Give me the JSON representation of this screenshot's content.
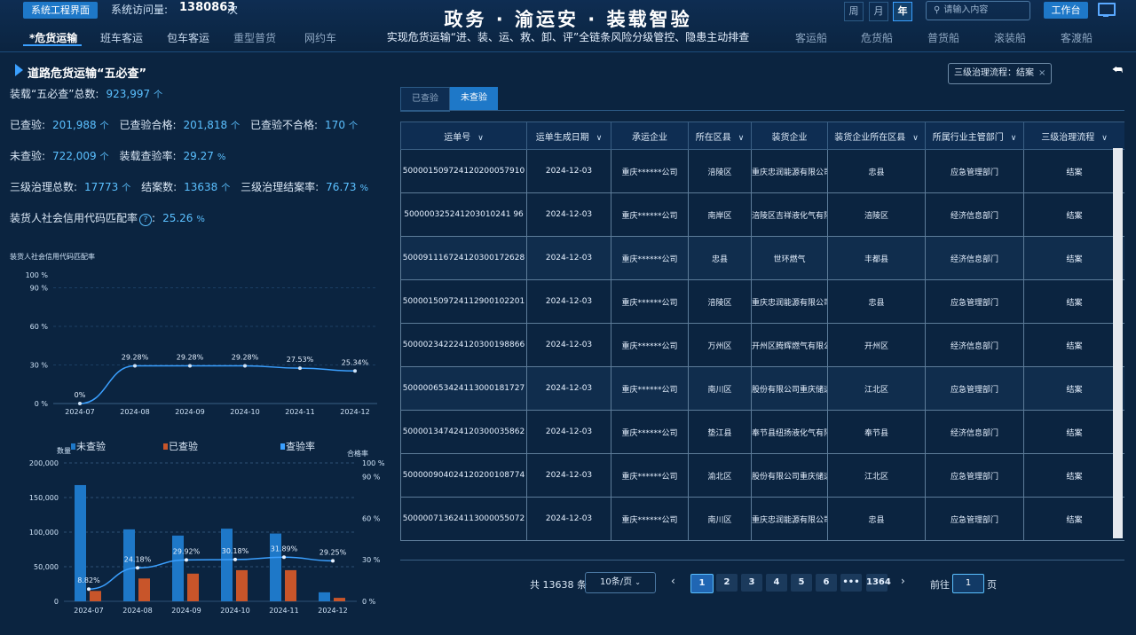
{
  "header": {
    "system_button": "系统工程界面",
    "visit_label": "系统访问量:",
    "visit_count": "1380863",
    "visit_unit": "次",
    "title": "政务 · 渝运安 · 装载智验",
    "subtitle": "实现危货运输“进、装、运、救、卸、评”全链条风险分级管控、隐患主动排查",
    "periods": [
      "周",
      "月",
      "年"
    ],
    "active_period": "年",
    "search_placeholder": "请输入内容",
    "workbench_button": "工作台",
    "nav_left": [
      "*危货运输",
      "班车客运",
      "包车客运",
      "重型普货",
      "网约车"
    ],
    "nav_right": [
      "客运船",
      "危货船",
      "普货船",
      "滚装船",
      "客渡船"
    ],
    "active_nav": "*危货运输"
  },
  "left": {
    "section_title": "道路危货运输“五必查”",
    "stats": {
      "total_label": "装载“五必查”总数:",
      "total_value": "923,997",
      "unit": "个",
      "checked_label": "已查验:",
      "checked_value": "201,988",
      "qualified_label": "已查验合格:",
      "qualified_value": "201,818",
      "unqualified_label": "已查验不合格:",
      "unqualified_value": "170",
      "unchecked_label": "未查验:",
      "unchecked_value": "722,009",
      "rate_label": "装载查验率:",
      "rate_value": "29.27",
      "pct": "%",
      "gov_total_label": "三级治理总数:",
      "gov_total_value": "17773",
      "closed_label": "结案数:",
      "closed_value": "13638",
      "closed_rate_label": "三级治理结案率:",
      "closed_rate_value": "76.73",
      "match_label": "装货人社会信用代码匹配率",
      "match_value": "25.26"
    }
  },
  "chart_data": [
    {
      "type": "line",
      "title": "装货人社会信用代码匹配率",
      "x": [
        "2024-07",
        "2024-08",
        "2024-09",
        "2024-10",
        "2024-11",
        "2024-12"
      ],
      "values": [
        0,
        29.28,
        29.28,
        29.28,
        27.53,
        25.34
      ],
      "data_labels": [
        "0%",
        "29.28%",
        "29.28%",
        "29.28%",
        "27.53%",
        "25.34%"
      ],
      "yticks": [
        "0 %",
        "30 %",
        "60 %",
        "90 %",
        "100 %"
      ],
      "ylim": [
        0,
        100
      ],
      "color": "#3ba0ff"
    },
    {
      "type": "bar",
      "ylabel": "数量",
      "ylabel_right": "合格率",
      "categories": [
        "2024-07",
        "2024-08",
        "2024-09",
        "2024-10",
        "2024-11",
        "2024-12"
      ],
      "series": [
        {
          "name": "未查验",
          "values": [
            168000,
            104000,
            95000,
            105000,
            98000,
            13000
          ],
          "color": "#1e78c8"
        },
        {
          "name": "已查验",
          "values": [
            15000,
            33000,
            40000,
            45000,
            45000,
            5000
          ],
          "color": "#c8552a"
        },
        {
          "name": "查验率",
          "values": [
            8.82,
            24.18,
            29.92,
            30.18,
            31.89,
            29.25
          ],
          "color": "#3ba0ff",
          "axis": "right",
          "data_labels": [
            "8.82%",
            "24.18%",
            "29.92%",
            "30.18%",
            "31.89%",
            "29.25%"
          ]
        }
      ],
      "yticks_left": [
        "0",
        "50,000",
        "100,000",
        "150,000",
        "200,000"
      ],
      "ylim": [
        0,
        200000
      ],
      "yticks_right": [
        "0 %",
        "30 %",
        "60 %",
        "90 %",
        "100 %"
      ],
      "ylim_right": [
        0,
        100
      ]
    }
  ],
  "right": {
    "filter_tag": "三级治理流程：结案",
    "tabs": [
      "已查验",
      "未查验"
    ],
    "active_tab": "未查验",
    "columns": [
      "运单号",
      "运单生成日期",
      "承运企业",
      "所在区县",
      "装货企业",
      "装货企业所在区县",
      "所属行业主管部门",
      "三级治理流程"
    ],
    "rows": [
      [
        "500001509724120200057910",
        "2024-12-03",
        "重庆******公司",
        "涪陵区",
        "重庆忠润能源有限公司",
        "忠县",
        "应急管理部门",
        "结案"
      ],
      [
        "500000325241203010241 96",
        "2024-12-03",
        "重庆******公司",
        "南岸区",
        "涪陵区吉祥液化气有限公司",
        "涪陵区",
        "经济信息部门",
        "结案"
      ],
      [
        "500091116724120300172628",
        "2024-12-03",
        "重庆******公司",
        "忠县",
        "世环燃气",
        "丰都县",
        "经济信息部门",
        "结案"
      ],
      [
        "500001509724112900102201",
        "2024-12-03",
        "重庆******公司",
        "涪陵区",
        "重庆忠润能源有限公司",
        "忠县",
        "应急管理部门",
        "结案"
      ],
      [
        "500002342224120300198866",
        "2024-12-03",
        "重庆******公司",
        "万州区",
        "开州区腾辉燃气有限公司",
        "开州区",
        "经济信息部门",
        "结案"
      ],
      [
        "500000653424113000181727",
        "2024-12-03",
        "重庆******公司",
        "南川区",
        "股份有限公司重庆储运",
        "江北区",
        "应急管理部门",
        "结案"
      ],
      [
        "500001347424120300035862",
        "2024-12-03",
        "重庆******公司",
        "垫江县",
        "奉节县纽扬液化气有限公司",
        "奉节县",
        "经济信息部门",
        "结案"
      ],
      [
        "500000904024120200108774",
        "2024-12-03",
        "重庆******公司",
        "渝北区",
        "股份有限公司重庆储运",
        "江北区",
        "应急管理部门",
        "结案"
      ],
      [
        "500000713624113000055072",
        "2024-12-03",
        "重庆******公司",
        "南川区",
        "重庆忠润能源有限公司",
        "忠县",
        "应急管理部门",
        "结案"
      ]
    ],
    "pagination": {
      "total_text": "共 13638 条",
      "page_size": "10条/页",
      "pages": [
        "1",
        "2",
        "3",
        "4",
        "5",
        "6",
        "•••",
        "1364"
      ],
      "current": "1",
      "goto_label": "前往",
      "goto_value": "1",
      "goto_unit": "页"
    }
  }
}
